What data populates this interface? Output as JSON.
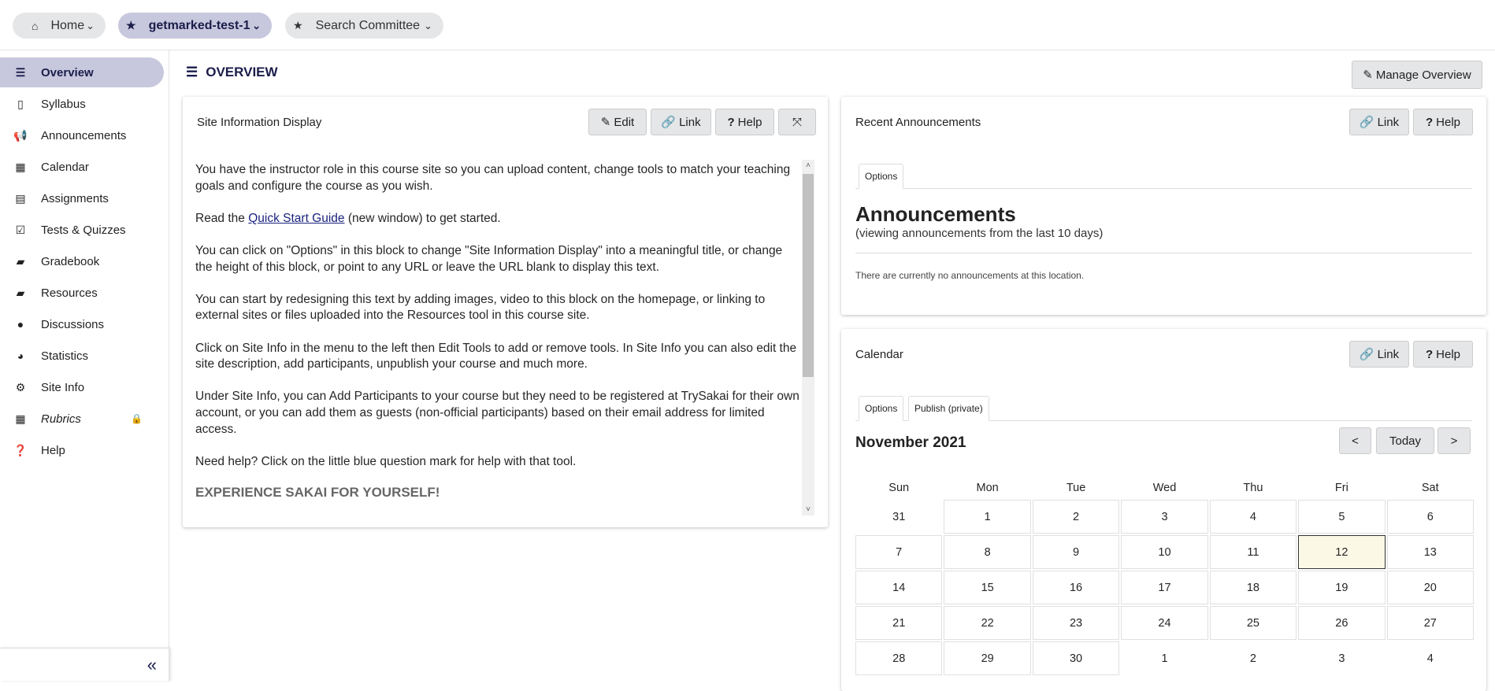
{
  "topbar": {
    "sites": [
      {
        "label": "Home",
        "icon": "home-icon"
      },
      {
        "label": "getmarked-test-1",
        "icon": "star-icon",
        "active": true
      },
      {
        "label": "Search Committee",
        "icon": "star-icon"
      }
    ]
  },
  "sidebar": {
    "items": [
      {
        "label": "Overview",
        "icon": "list-icon",
        "active": true
      },
      {
        "label": "Syllabus",
        "icon": "map-icon"
      },
      {
        "label": "Announcements",
        "icon": "bullhorn-icon"
      },
      {
        "label": "Calendar",
        "icon": "calendar-icon"
      },
      {
        "label": "Assignments",
        "icon": "file-icon"
      },
      {
        "label": "Tests & Quizzes",
        "icon": "checkbox-icon"
      },
      {
        "label": "Gradebook",
        "icon": "book-icon"
      },
      {
        "label": "Resources",
        "icon": "folder-open-icon"
      },
      {
        "label": "Discussions",
        "icon": "comments-icon"
      },
      {
        "label": "Statistics",
        "icon": "pie-chart-icon"
      },
      {
        "label": "Site Info",
        "icon": "gear-icon"
      },
      {
        "label": "Rubrics",
        "icon": "table-icon",
        "locked": true
      },
      {
        "label": "Help",
        "icon": "question-circle-icon"
      }
    ],
    "collapse_icon": "double-chevron-left-icon"
  },
  "page": {
    "title": "OVERVIEW",
    "manage_label": "Manage Overview"
  },
  "site_info": {
    "title": "Site Information Display",
    "edit": "Edit",
    "link": "Link",
    "help": "Help",
    "p1": "You have the instructor role in this course site so you can upload content, change tools to match your teaching goals and configure the course as you wish.",
    "p2_pre": "Read the ",
    "p2_link": "Quick Start Guide",
    "p2_post": " (new window) to get started.",
    "p3": "You can click on \"Options\" in this block to change \"Site Information Display\" into a meaningful title, or change the height of this block, or point to any URL or leave the URL blank to display this text.",
    "p4": "You can start by redesigning this text by adding images, video to this block on the homepage, or linking to external sites or files uploaded into the Resources tool in this course site.",
    "p5": "Click on Site Info in the menu to the left then Edit Tools to add or remove tools.  In Site Info you can also edit the site description, add participants, unpublish your course and much more.",
    "p6": "Under Site Info, you can Add Participants to your course but they need to be registered at TrySakai for their own account, or you can add them as guests (non-official participants) based on their email address for limited access.",
    "p7": "Need help?  Click on the little blue question mark for help with that tool.",
    "h": "EXPERIENCE SAKAI FOR YOURSELF!"
  },
  "announcements": {
    "title": "Recent Announcements",
    "link": "Link",
    "help": "Help",
    "tab": "Options",
    "heading": "Announcements",
    "subtitle": "(viewing announcements from the last 10 days)",
    "empty": "There are currently no announcements at this location."
  },
  "calendar": {
    "title": "Calendar",
    "link": "Link",
    "help": "Help",
    "tabs": [
      "Options",
      "Publish (private)"
    ],
    "month": "November 2021",
    "prev": "<",
    "today": "Today",
    "next": ">",
    "days": [
      "Sun",
      "Mon",
      "Tue",
      "Wed",
      "Thu",
      "Fri",
      "Sat"
    ],
    "weeks": [
      [
        "31",
        "1",
        "2",
        "3",
        "4",
        "5",
        "6"
      ],
      [
        "7",
        "8",
        "9",
        "10",
        "11",
        "12",
        "13"
      ],
      [
        "14",
        "15",
        "16",
        "17",
        "18",
        "19",
        "20"
      ],
      [
        "21",
        "22",
        "23",
        "24",
        "25",
        "26",
        "27"
      ],
      [
        "28",
        "29",
        "30",
        "1",
        "2",
        "3",
        "4"
      ]
    ],
    "today_date": "12"
  }
}
